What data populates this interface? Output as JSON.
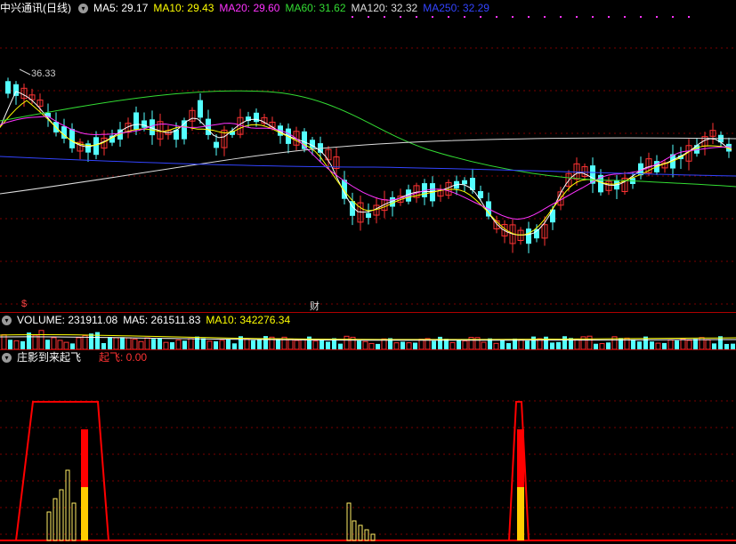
{
  "main": {
    "title": "中兴通讯(日线)",
    "ma": [
      {
        "label": "MA5: 29.17",
        "color": "#ffffff"
      },
      {
        "label": "MA10: 29.43",
        "color": "#ffff00"
      },
      {
        "label": "MA20: 29.60",
        "color": "#ff33ff"
      },
      {
        "label": "MA60: 31.62",
        "color": "#33dd33"
      },
      {
        "label": "MA120: 32.32",
        "color": "#dddddd"
      },
      {
        "label": "MA250: 32.29",
        "color": "#3344ff"
      }
    ],
    "high_label": "36.33",
    "marker_s": "$",
    "marker_cai": "财"
  },
  "volume": {
    "label": "VOLUME: 231911.08",
    "ma5": "MA5: 261511.83",
    "ma10": "MA10: 342276.34"
  },
  "indicator": {
    "title": "庄影到来起飞",
    "value": "起飞: 0.00"
  },
  "colors": {
    "up": "#ff3333",
    "down": "#54ffff",
    "grid": "#7a0000",
    "signal": "#ff0000",
    "bar_yellow": "#ffcc00"
  }
}
